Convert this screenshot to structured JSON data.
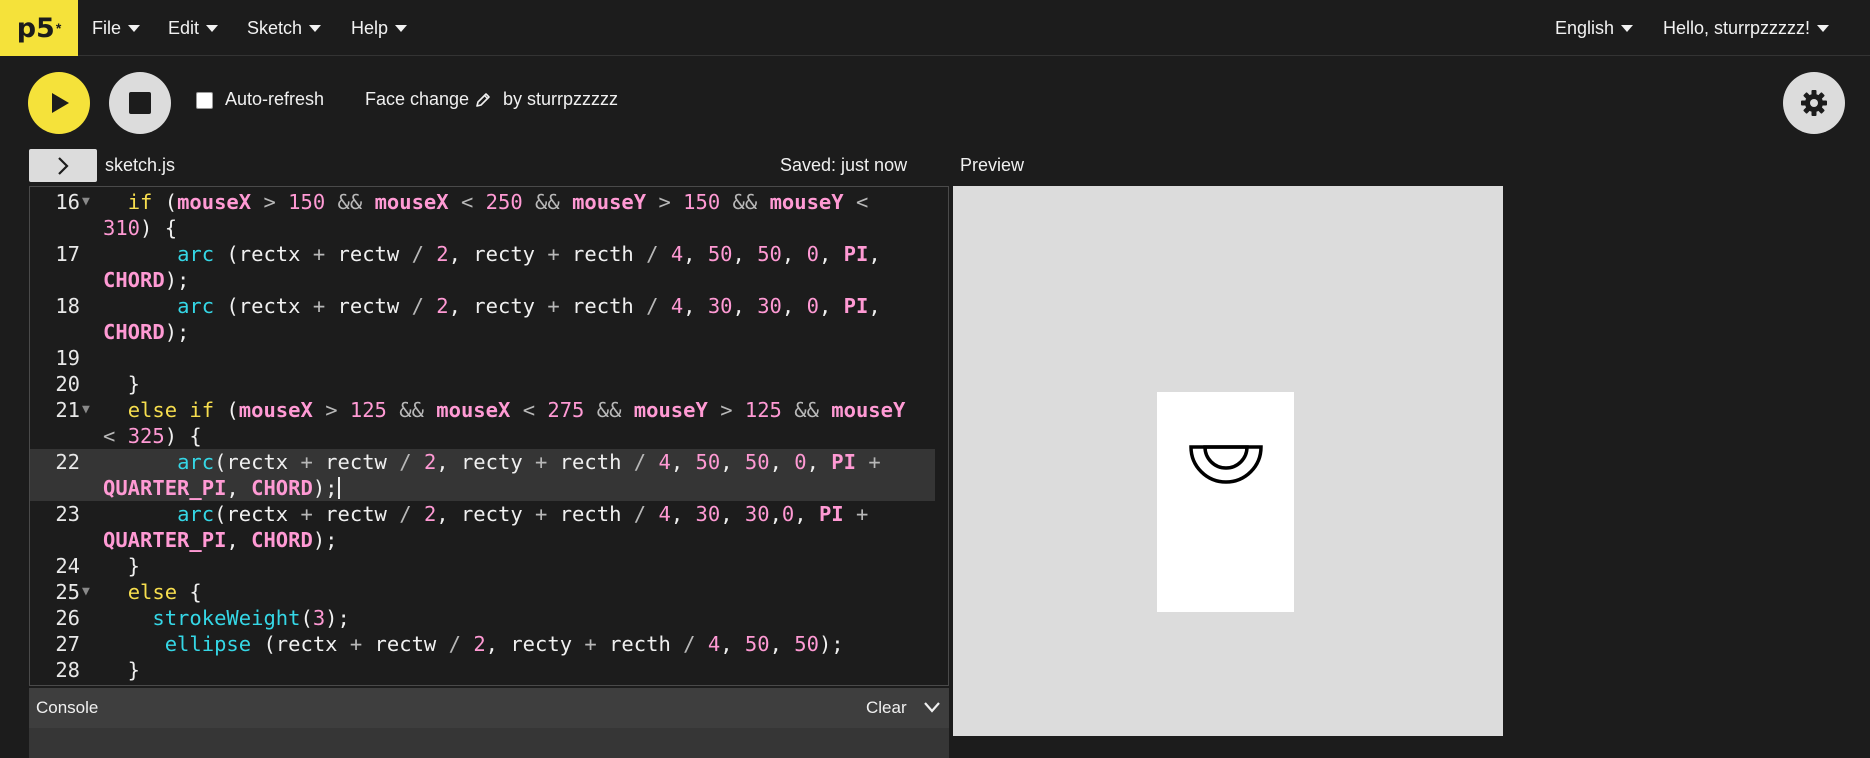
{
  "nav": {
    "logo": "p5",
    "logo_star": "*",
    "menus": [
      "File",
      "Edit",
      "Sketch",
      "Help"
    ],
    "language": "English",
    "user_greeting": "Hello, sturrpzzzzz!"
  },
  "toolbar": {
    "play_icon": "play-icon",
    "stop_icon": "stop-icon",
    "auto_refresh_label": "Auto-refresh",
    "auto_refresh_checked": false,
    "sketch_name": "Face change",
    "owner": "by sturrpzzzzz",
    "settings_icon": "gear-icon"
  },
  "editor": {
    "file_name": "sketch.js",
    "saved_status": "Saved: just now",
    "active_line": 22,
    "lines": [
      {
        "n": "16",
        "fold": true,
        "text": "  if (mouseX > 150 && mouseX < 250 && mouseY > 150 && mouseY <"
      },
      {
        "n": "",
        "fold": false,
        "text": "310) {"
      },
      {
        "n": "17",
        "fold": false,
        "text": "      arc (rectx + rectw / 2, recty + recth / 4, 50, 50, 0, PI,"
      },
      {
        "n": "",
        "fold": false,
        "text": "CHORD);"
      },
      {
        "n": "18",
        "fold": false,
        "text": "      arc (rectx + rectw / 2, recty + recth / 4, 30, 30, 0, PI,"
      },
      {
        "n": "",
        "fold": false,
        "text": "CHORD);"
      },
      {
        "n": "19",
        "fold": false,
        "text": ""
      },
      {
        "n": "20",
        "fold": false,
        "text": "  }"
      },
      {
        "n": "21",
        "fold": true,
        "text": "  else if (mouseX > 125 && mouseX < 275 && mouseY > 125 && mouseY"
      },
      {
        "n": "",
        "fold": false,
        "text": "< 325) {"
      },
      {
        "n": "22",
        "fold": false,
        "text": "      arc(rectx + rectw / 2, recty + recth / 4, 50, 50, 0, PI +"
      },
      {
        "n": "",
        "fold": false,
        "text": "QUARTER_PI, CHORD);"
      },
      {
        "n": "23",
        "fold": false,
        "text": "      arc(rectx + rectw / 2, recty + recth / 4, 30, 30,0, PI +"
      },
      {
        "n": "",
        "fold": false,
        "text": "QUARTER_PI, CHORD);"
      },
      {
        "n": "24",
        "fold": false,
        "text": "  }"
      },
      {
        "n": "25",
        "fold": true,
        "text": "  else {"
      },
      {
        "n": "26",
        "fold": false,
        "text": "    strokeWeight(3);"
      },
      {
        "n": "27",
        "fold": false,
        "text": "     ellipse (rectx + rectw / 2, recty + recth / 4, 50, 50);"
      },
      {
        "n": "28",
        "fold": false,
        "text": "  }"
      }
    ]
  },
  "console": {
    "title": "Console",
    "clear_label": "Clear"
  },
  "preview": {
    "label": "Preview",
    "canvas_background": "#dcdcdc",
    "card_color": "#ffffff",
    "stroke_color": "#000000"
  },
  "colors": {
    "p5_yellow": "#f5e23a",
    "background": "#1c1c1c",
    "keyword": "#f7de4e",
    "function": "#35d7e6",
    "number": "#ff9ad4"
  }
}
